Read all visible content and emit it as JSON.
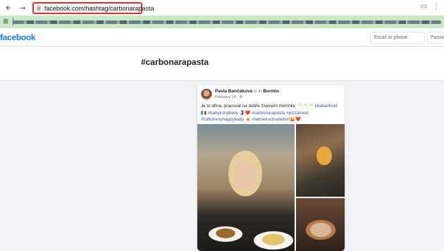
{
  "browser": {
    "back_icon": "back-arrow-icon",
    "forward_glyph": "→",
    "reload_glyph": "↻",
    "url": "facebook.com/hashtag/carbonarapasta",
    "site_info_icon": "tune-icon"
  },
  "facebook": {
    "logo": "facebook",
    "email_placeholder": "Email or phone",
    "password_placeholder": "Passw"
  },
  "page": {
    "hashtag_title": "#carbonarapasta"
  },
  "post": {
    "author": "Pavla Bančáková",
    "is_in": "is in",
    "location": "Bormio",
    "date": "February 14 · ⚙",
    "text_plain_1": "Je to dřina, pracovat na dobře živeném mimínku 🥂🥂🥂 ",
    "tag_1": "#italianfood",
    "text_plain_2": " 🇮🇹 ",
    "tag_2": "#babyinmybelly",
    "text_plain_3": " 🤰❤️ ",
    "tag_3": "#carbonarapasta",
    "text_plain_4": " ",
    "tag_4": "#pizzalover",
    "text_plain_5": " ",
    "tag_5": "#fulltummyhappybaby",
    "text_plain_6": " 🍝 ",
    "tag_6": "#tatinekscbudedivit",
    "text_plain_7": "😜❤️"
  }
}
